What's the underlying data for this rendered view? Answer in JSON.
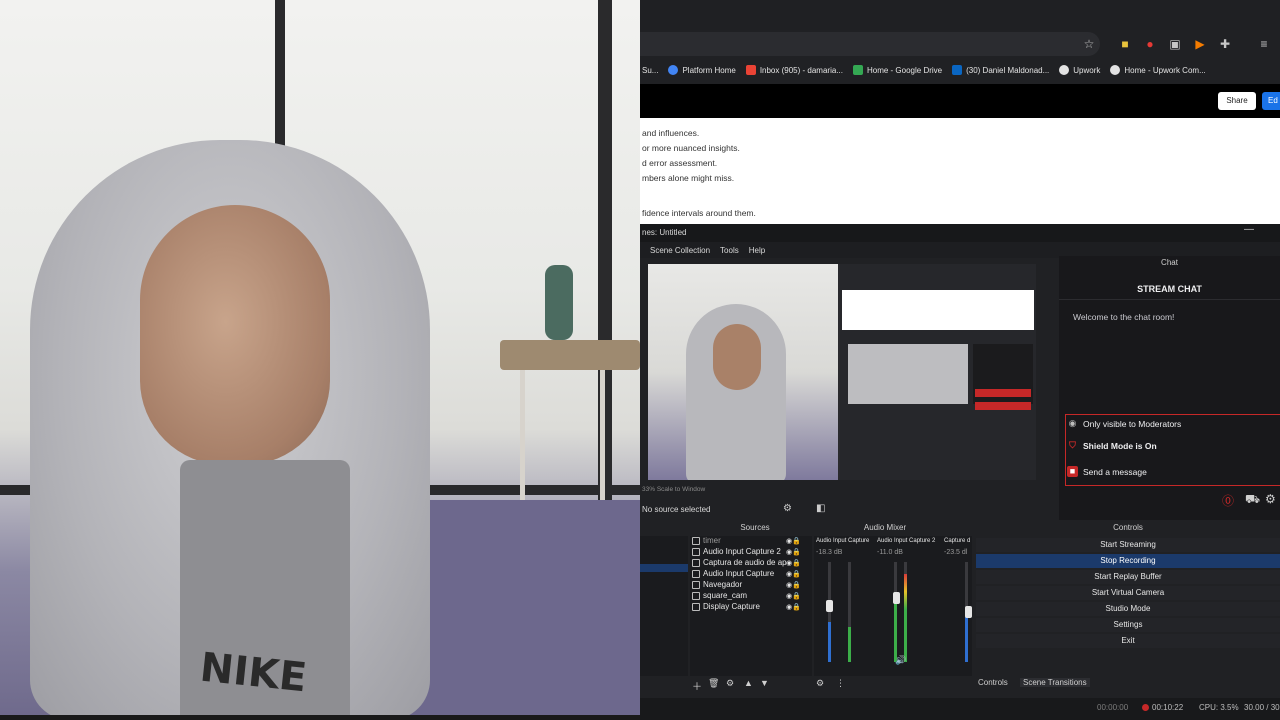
{
  "browser": {
    "bookmarks": [
      {
        "label": "Su...",
        "color": "#e8ab3c"
      },
      {
        "label": "Platform Home",
        "color": "#4285f4"
      },
      {
        "label": "Inbox (905) - damaria...",
        "color": "#ea4335"
      },
      {
        "label": "Home - Google Drive",
        "color": "#34a853"
      },
      {
        "label": "(30) Daniel Maldonad...",
        "color": "#0a66c2"
      },
      {
        "label": "Upwork",
        "color": "#e3e3e3"
      },
      {
        "label": "Home - Upwork Com...",
        "color": "#e3e3e3"
      }
    ],
    "share_label": "Share",
    "edit_label": "Ed",
    "doc_lines": [
      " and influences.",
      "or more nuanced insights.",
      "d error assessment.",
      "mbers alone might miss.",
      "fidence intervals around them."
    ]
  },
  "obs": {
    "title": "nes: Untitled",
    "menu": [
      "Scene Collection",
      "Tools",
      "Help"
    ],
    "preview_scale": "33% Scale to Window",
    "no_source": "No source selected",
    "docks": {
      "sources": "Sources",
      "mixer": "Audio Mixer",
      "controls": "Controls"
    },
    "sources": [
      {
        "label": "timer",
        "dim": true
      },
      {
        "label": "Audio Input Capture 2",
        "dim": false
      },
      {
        "label": "Captura de audio de ap",
        "dim": false
      },
      {
        "label": "Audio Input Capture",
        "dim": false
      },
      {
        "label": "Navegador",
        "dim": false
      },
      {
        "label": "square_cam",
        "dim": false
      },
      {
        "label": "Display Capture",
        "dim": false
      }
    ],
    "mixer": [
      {
        "label": "Audio Input Capture",
        "db": "-18.3 dB"
      },
      {
        "label": "Audio Input Capture 2",
        "db": "-11.0 dB"
      },
      {
        "label": "Capture d",
        "db": "-23.5 dl"
      }
    ],
    "controls": [
      {
        "label": "Start Streaming",
        "active": false
      },
      {
        "label": "Stop Recording",
        "active": true
      },
      {
        "label": "Start Replay Buffer",
        "active": false
      },
      {
        "label": "Start Virtual Camera",
        "active": false
      },
      {
        "label": "Studio Mode",
        "active": false
      },
      {
        "label": "Settings",
        "active": false
      },
      {
        "label": "Exit",
        "active": false
      }
    ],
    "bottom_tabs": [
      "Controls",
      "Scene Transitions"
    ],
    "status": {
      "stream_time": "00:00:00",
      "rec_time": "00:10:22",
      "cpu": "CPU: 3.5%",
      "fps": "30.00 / 30"
    }
  },
  "chat": {
    "tab": "Chat",
    "header": "STREAM CHAT",
    "welcome": "Welcome to the chat room!",
    "mod_only": "Only visible to Moderators",
    "shield": "Shield Mode is On",
    "send": "Send a message"
  },
  "webcam": {
    "shirt_text": "NIKE"
  }
}
